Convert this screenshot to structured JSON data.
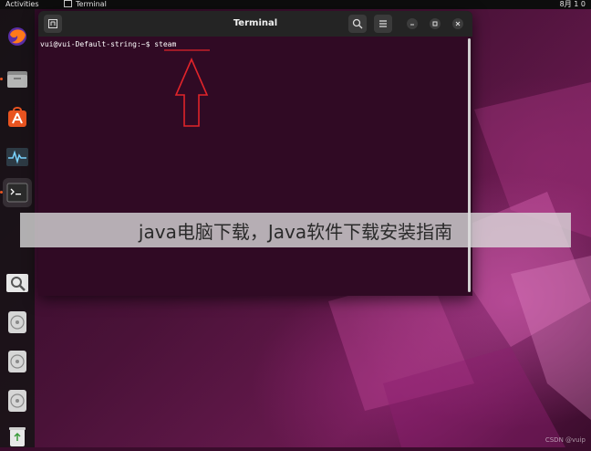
{
  "topbar": {
    "activities": "Activities",
    "app_name": "Terminal",
    "clock": "8月 1 0"
  },
  "dock": {
    "items": [
      {
        "icon": "firefox-icon"
      },
      {
        "icon": "files-icon"
      },
      {
        "icon": "software-store-icon"
      },
      {
        "icon": "system-monitor-icon"
      },
      {
        "icon": "terminal-icon",
        "active": true
      },
      {
        "icon": "image-viewer-icon"
      },
      {
        "icon": "disc-icon"
      },
      {
        "icon": "disc-icon"
      },
      {
        "icon": "disc-icon"
      },
      {
        "icon": "trash-icon"
      }
    ]
  },
  "terminal": {
    "title": "Terminal",
    "prompt": "vui@vui-Default-string:~$ ",
    "command": "steam"
  },
  "banner": {
    "text": "java电脑下载，Java软件下载安装指南"
  },
  "watermark": "CSDN @vuip",
  "colors": {
    "terminal_bg": "#300a24",
    "titlebar_bg": "#242424",
    "annotation_red": "#e0242a",
    "accent": "#e95420"
  }
}
